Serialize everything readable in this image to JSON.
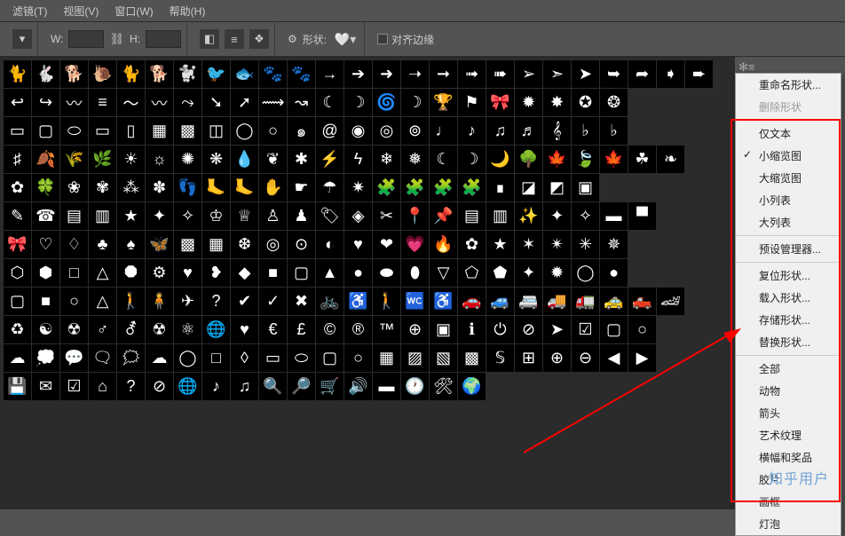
{
  "menubar": {
    "items": [
      "滤镜(T)",
      "视图(V)",
      "窗口(W)",
      "帮助(H)"
    ]
  },
  "toolbar": {
    "w_label": "W:",
    "w_value": "",
    "h_label": "H:",
    "h_value": "",
    "shape_label": "形状:",
    "align_label": "对齐边缘"
  },
  "context_menu": {
    "rename": "重命名形状...",
    "delete": "删除形状",
    "text_only": "仅文本",
    "small_thumb": "小缩览图",
    "large_thumb": "大缩览图",
    "small_list": "小列表",
    "large_list": "大列表",
    "preset_manager": "预设管理器...",
    "reset": "复位形状...",
    "load": "载入形状...",
    "save": "存储形状...",
    "replace": "替换形状...",
    "all": "全部",
    "animals": "动物",
    "arrows": "箭头",
    "artistic": "艺术纹理",
    "banners": "横幅和奖品",
    "film": "胶片",
    "frames": "画框",
    "bulb": "灯泡"
  },
  "watermark": "知乎用户",
  "shapes": {
    "rows": [
      [
        "cat",
        "rabbit",
        "dog",
        "snail",
        "cat2",
        "dog2",
        "dog3",
        "bird",
        "fish",
        "paw",
        "paw2",
        "arrow-r",
        "arrow-r2",
        "arrow-r3",
        "arrow-r4",
        "arrow-r5",
        "arrow-r6",
        "arrow-r7",
        "arrow-r8",
        "arrow-r9",
        "arrow-r10",
        "arrow-r11",
        "arrow-r12",
        "arrow-r13",
        "arrow-r14"
      ],
      [
        "arrow-back",
        "arrow-turn",
        "scribble",
        "lines",
        "wave",
        "wave2",
        "curve",
        "swoosh",
        "swoosh2",
        "curve2",
        "curve3",
        "moon",
        "crescent",
        "spiral",
        "crescent2",
        "trophy",
        "flag",
        "ribbon",
        "burst",
        "burst2",
        "seal",
        "seal2",
        "",
        "",
        " "
      ],
      [
        "plaque",
        "frame",
        "oval",
        "frame2",
        "frame3",
        "stamp",
        "stamp2",
        "frame4",
        "circle",
        "circle2",
        "whirl",
        "spiral2",
        "orb",
        "ripple",
        "ripple2",
        "note",
        "note2",
        "note8",
        "note3",
        "clef",
        "note4",
        "flat",
        "",
        "",
        ""
      ],
      [
        "sharp",
        "leaf",
        "wheat",
        "fern",
        "sun",
        "sun2",
        "sun3",
        "sun4",
        "drop",
        "drop2",
        "blot",
        "bolt",
        "bolt2",
        "snow",
        "snow2",
        "moon2",
        "moon3",
        "moon4",
        "tree",
        "leaf2",
        "leaf3",
        "maple",
        "clover",
        "leaf4",
        ""
      ],
      [
        "flower",
        "clover2",
        "flower2",
        "daisy",
        "grass",
        "petal",
        "foot",
        "foot2",
        "foot3",
        "hand",
        "hand2",
        "umbrella",
        "burst3",
        "puzzle",
        "puzzle2",
        "puzzle3",
        "puzzle4",
        "jigsaw",
        "jigsaw2",
        "jigsaw3",
        "jigsaw4",
        "",
        "",
        "",
        " "
      ],
      [
        "pencil",
        "phone",
        "book",
        "tile",
        "star",
        "star2",
        "star3",
        "crown",
        "crown2",
        "chess",
        "chess2",
        "tag",
        "tag2",
        "scissor",
        "pin",
        "pin2",
        "stamp3",
        "stamp4",
        "sparkle",
        "sparkle2",
        "sparkle3",
        "flag2",
        "flag3",
        "",
        ""
      ],
      [
        "bow",
        "heart2",
        "diamond",
        "club",
        "spade",
        "butterfly",
        "tile2",
        "pattern",
        "snow3",
        "target",
        "target2",
        "half",
        "heart3",
        "heart4",
        "heart5",
        "fire",
        "flower3",
        "star4",
        "star5",
        "star6",
        "star7",
        "star8",
        "",
        "",
        ""
      ],
      [
        "hex",
        "hex2",
        "square",
        "triangle",
        "oct",
        "gear2",
        "heart6",
        "heart7",
        "diamond2",
        "square2",
        "rrect",
        "triangle2",
        "circle3",
        "blob",
        "blob2",
        "triangle3",
        "poly",
        "poly2",
        "star9",
        "burst4",
        "circle4",
        "circle5",
        "",
        "",
        ""
      ],
      [
        "square3",
        "square4",
        "circle6",
        "triangle4",
        "person",
        "person2",
        "plane",
        "question",
        "check",
        "check2",
        "cross",
        "bike",
        "chair",
        "walk",
        "wc",
        "wheel",
        "car",
        "car2",
        "car3",
        "car4",
        "car5",
        "car6",
        "car7",
        "car8",
        ""
      ],
      [
        "recycle",
        "yinyang",
        "radio",
        "male",
        "male2",
        "nuclear",
        "atom",
        "globe",
        "heart8",
        "euro",
        "pound",
        "copy",
        "reg",
        "tm",
        "cross2",
        "square5",
        "info",
        "power",
        "no",
        "cursor",
        "check3",
        "square6",
        "circle7",
        "",
        ""
      ],
      [
        "cloud",
        "cloud2",
        "bubble",
        "bubble2",
        "bubble3",
        "cloud3",
        "bubble4",
        "bubble5",
        "bubble6",
        "bubble7",
        "bubble8",
        "bubble9",
        "bubble10",
        "fence",
        "hatch",
        "hatch2",
        "pattern2",
        "sos",
        "grid",
        "plus",
        "minus",
        "left-c",
        "right-c",
        "",
        ""
      ],
      [
        "save",
        "mail",
        "checkbox",
        "home",
        "help",
        "no2",
        "globe2",
        "music",
        "music2",
        "search",
        "search2",
        "cart",
        "vol",
        "dash",
        "clock",
        "tools",
        "world",
        "",
        "",
        "",
        "",
        "",
        "",
        "",
        ""
      ]
    ]
  }
}
